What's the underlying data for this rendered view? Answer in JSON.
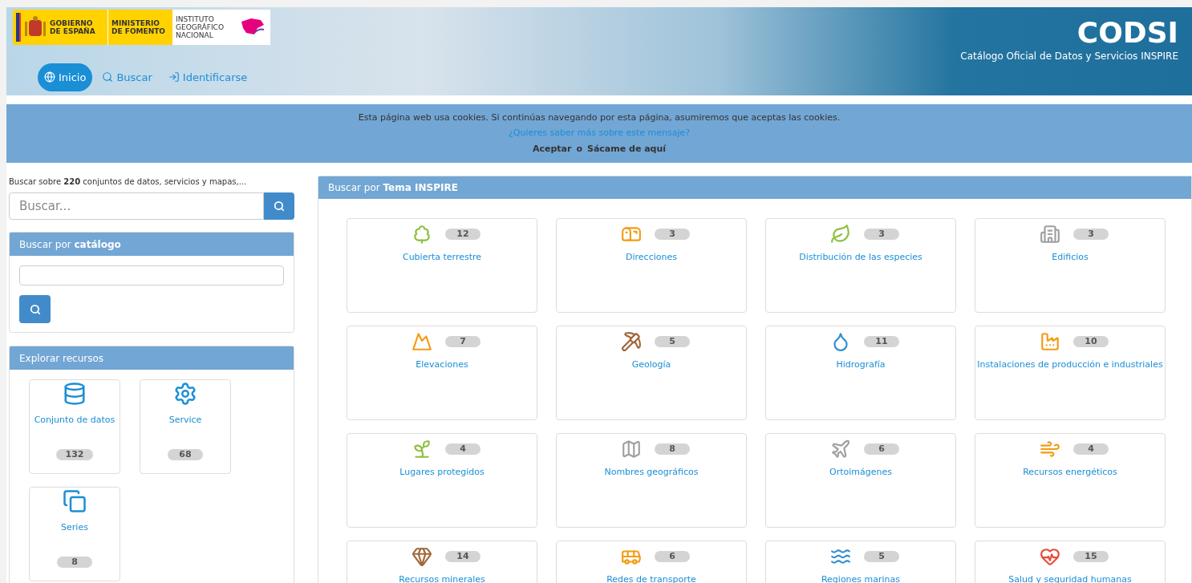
{
  "header": {
    "logos": [
      {
        "kind": "gobierno",
        "text": "GOBIERNO DE ESPAÑA"
      },
      {
        "kind": "ministerio",
        "text": "MINISTERIO DE FOMENTO"
      },
      {
        "kind": "ign",
        "text": "INSTITUTO GEOGRÁFICO NACIONAL"
      }
    ],
    "nav": [
      {
        "label": "Inicio",
        "selected": true
      },
      {
        "label": "Buscar",
        "selected": false
      },
      {
        "label": "Identificarse",
        "selected": false
      }
    ],
    "title": "CODSI",
    "subtitle": "Catálogo Oficial de Datos y Servicios INSPIRE"
  },
  "cookie_banner": {
    "message": "Esta página web usa cookies. Si continúas navegando por esta página, asumiremos que aceptas las cookies.",
    "link": "¿Quieres saber más sobre este mensaje?",
    "accept": "Aceptar",
    "separator": "o",
    "leave": "Sácame de aquí"
  },
  "search": {
    "intro": "Buscar sobre **220** conjuntos de datos, servicios y mapas,...",
    "placeholder": "Buscar..."
  },
  "catalog_panel": {
    "title": "Buscar por **catálogo**"
  },
  "resources_panel": {
    "title": "Explorar recursos",
    "items": [
      {
        "label": "Conjunto de datos",
        "count": "132"
      },
      {
        "label": "Service",
        "count": "68"
      },
      {
        "label": "Series",
        "count": "8"
      }
    ]
  },
  "themes_panel": {
    "title": "Buscar por **Tema INSPIRE**",
    "items": [
      {
        "color": "#8cbf3f",
        "label": "Cubierta terrestre",
        "count": "12"
      },
      {
        "color": "#f39c12",
        "label": "Direcciones",
        "count": "3"
      },
      {
        "color": "#8cbf3f",
        "label": "Distribución de las especies",
        "count": "3"
      },
      {
        "color": "#a0a0a0",
        "label": "Edificios",
        "count": "3"
      },
      {
        "color": "#f39c12",
        "label": "Elevaciones",
        "count": "7"
      },
      {
        "color": "#a0683a",
        "label": "Geología",
        "count": "5"
      },
      {
        "color": "#2e8fd0",
        "label": "Hidrografía",
        "count": "11"
      },
      {
        "color": "#f39c12",
        "label": "Instalaciones de producción e industriales",
        "count": "10"
      },
      {
        "color": "#8cbf3f",
        "label": "Lugares protegidos",
        "count": "4"
      },
      {
        "color": "#a0a0a0",
        "label": "Nombres geográficos",
        "count": "8"
      },
      {
        "color": "#a0a0a0",
        "label": "Ortoimágenes",
        "count": "6"
      },
      {
        "color": "#f39c12",
        "label": "Recursos energéticos",
        "count": "4"
      },
      {
        "color": "#a0683a",
        "label": "Recursos minerales",
        "count": "14"
      },
      {
        "color": "#f39c12",
        "label": "Redes de transporte",
        "count": "6"
      },
      {
        "color": "#2e8fd0",
        "label": "Regiones marinas",
        "count": "5"
      },
      {
        "color": "#e74c3c",
        "label": "Salud y seguridad humanas",
        "count": "15"
      }
    ]
  }
}
